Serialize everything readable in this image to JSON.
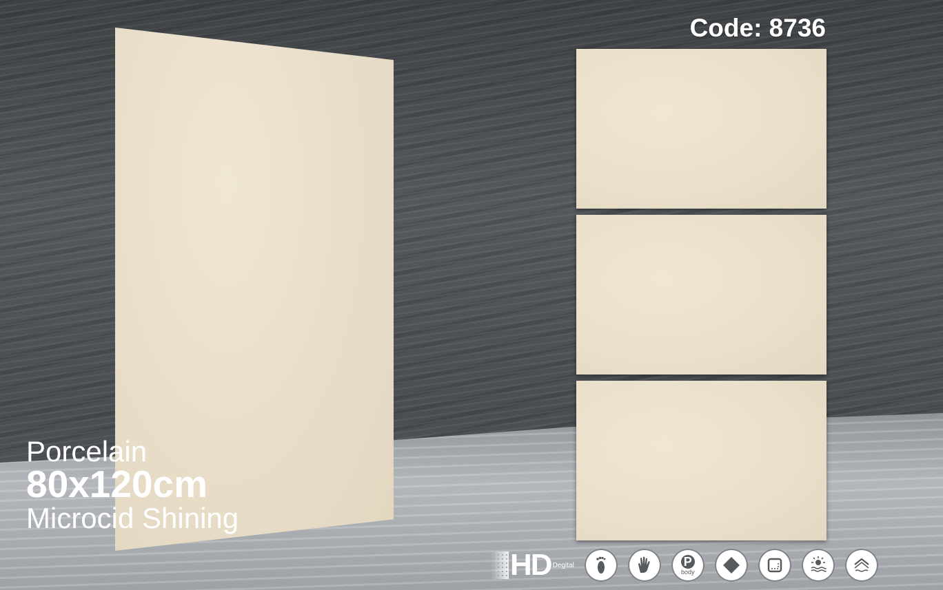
{
  "code_label": "Code: 8736",
  "product": {
    "material": "Porcelain",
    "size": "80x120cm",
    "finish": "Microcid Shining"
  },
  "badges": {
    "hd_label": "HD",
    "hd_sub": "Degital",
    "p_label": "P",
    "p_sub": "body"
  },
  "icons": [
    "hd-digital-icon",
    "footprint-icon",
    "hand-icon",
    "porcelain-body-icon",
    "diamond-icon",
    "rectified-edge-icon",
    "frost-resistant-icon",
    "water-absorption-icon"
  ],
  "colors": {
    "tile": "#e8ddc8",
    "wall": "#4f5357",
    "text": "#ffffff"
  }
}
